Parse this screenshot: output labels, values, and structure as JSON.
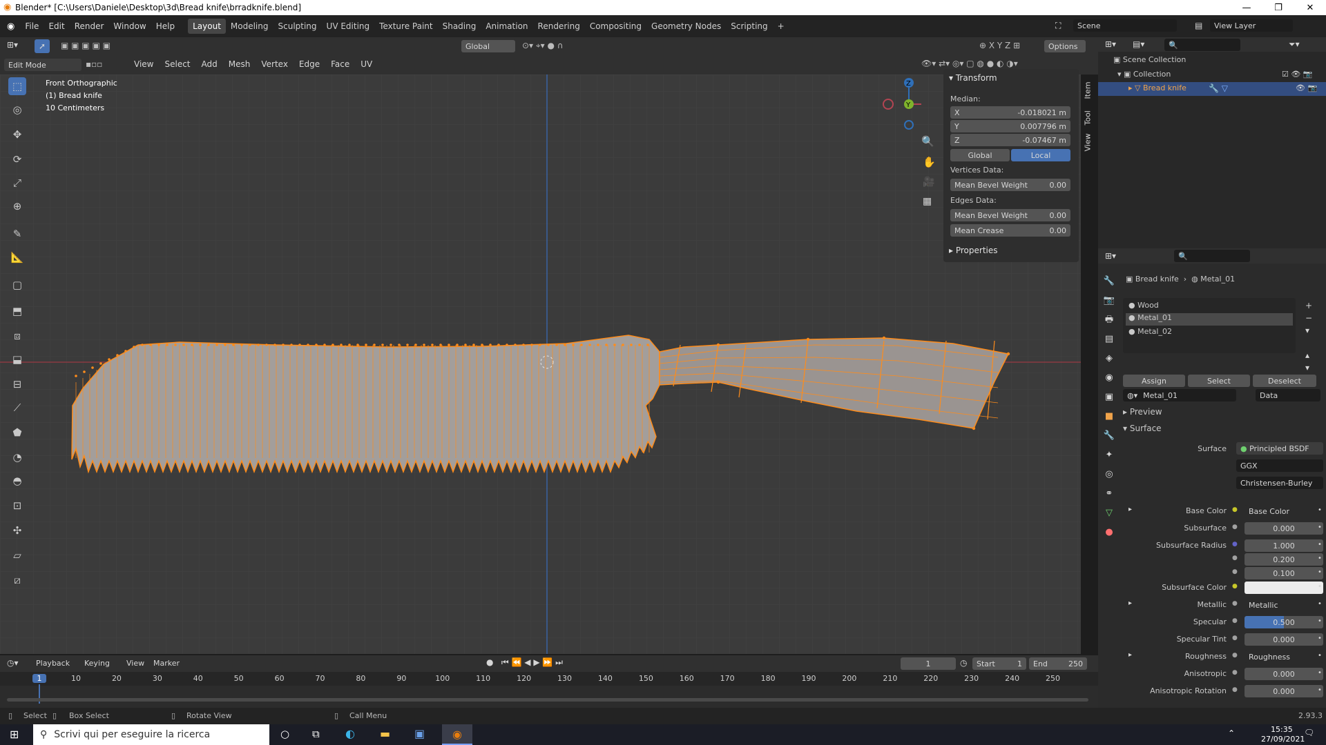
{
  "window": {
    "title": "Blender* [C:\\Users\\Daniele\\Desktop\\3d\\Bread knife\\brradknife.blend]"
  },
  "menus": [
    "File",
    "Edit",
    "Render",
    "Window",
    "Help"
  ],
  "workspaces": [
    "Layout",
    "Modeling",
    "Sculpting",
    "UV Editing",
    "Texture Paint",
    "Shading",
    "Animation",
    "Rendering",
    "Compositing",
    "Geometry Nodes",
    "Scripting"
  ],
  "scene": {
    "label": "Scene",
    "view_layer": "View Layer"
  },
  "header3d": {
    "mode": "Edit Mode",
    "transform_orient": "Global",
    "options": "Options",
    "menus": [
      "View",
      "Select",
      "Add",
      "Mesh",
      "Vertex",
      "Edge",
      "Face",
      "UV"
    ]
  },
  "overlay": {
    "line1": "Front Orthographic",
    "line2": "(1) Bread knife",
    "line3": "10 Centimeters"
  },
  "gizmo": {
    "x": "X",
    "y": "Y",
    "z": "Z"
  },
  "npanel": {
    "transform_title": "Transform",
    "median": "Median:",
    "x_label": "X",
    "x_val": "-0.018021 m",
    "y_label": "Y",
    "y_val": "0.007796 m",
    "z_label": "Z",
    "z_val": "-0.07467 m",
    "global": "Global",
    "local": "Local",
    "vertices_data": "Vertices Data:",
    "v_bevel_label": "Mean Bevel Weight",
    "v_bevel_val": "0.00",
    "edges_data": "Edges Data:",
    "e_bevel_label": "Mean Bevel Weight",
    "e_bevel_val": "0.00",
    "crease_label": "Mean Crease",
    "crease_val": "0.00",
    "properties": "Properties",
    "tabs": [
      "Item",
      "Tool",
      "View"
    ]
  },
  "outliner": {
    "scene_collection": "Scene Collection",
    "collection": "Collection",
    "object": "Bread knife"
  },
  "properties": {
    "breadcrumb_obj": "Bread knife",
    "breadcrumb_mat": "Metal_01",
    "slots": [
      "Wood",
      "Metal_01",
      "Metal_02"
    ],
    "assign": "Assign",
    "select": "Select",
    "deselect": "Deselect",
    "material_name": "Metal_01",
    "data": "Data",
    "preview": "Preview",
    "surface_section": "Surface",
    "surface_label": "Surface",
    "surface_val": "Principled BSDF",
    "distribution": "GGX",
    "subsurface_method": "Christensen-Burley",
    "rows": [
      {
        "label": "Base Color",
        "val": "Base Color"
      },
      {
        "label": "Subsurface",
        "val": "0.000"
      },
      {
        "label": "Subsurface Radius",
        "val": "1.000"
      },
      {
        "label": "",
        "val": "0.200"
      },
      {
        "label": "",
        "val": "0.100"
      },
      {
        "label": "Subsurface Color",
        "val": ""
      },
      {
        "label": "Metallic",
        "val": "Metallic"
      },
      {
        "label": "Specular",
        "val": "0.500"
      },
      {
        "label": "Specular Tint",
        "val": "0.000"
      },
      {
        "label": "Roughness",
        "val": "Roughness"
      },
      {
        "label": "Anisotropic",
        "val": "0.000"
      },
      {
        "label": "Anisotropic Rotation",
        "val": "0.000"
      }
    ],
    "specular_fill": 0.5
  },
  "timeline": {
    "menus": [
      "Playback",
      "Keying",
      "View",
      "Marker"
    ],
    "current_frame": "1",
    "start_label": "Start",
    "start": "1",
    "end_label": "End",
    "end": "250",
    "ticks": [
      "1",
      "10",
      "20",
      "30",
      "40",
      "50",
      "60",
      "70",
      "80",
      "90",
      "100",
      "110",
      "120",
      "130",
      "140",
      "150",
      "160",
      "170",
      "180",
      "190",
      "200",
      "210",
      "220",
      "230",
      "240",
      "250"
    ]
  },
  "status": {
    "select": "Select",
    "box_select": "Box Select",
    "rotate": "Rotate View",
    "call_menu": "Call Menu",
    "version": "2.93.3"
  },
  "taskbar": {
    "search": "Scrivi qui per eseguire la ricerca",
    "time": "15:35",
    "date": "27/09/2021"
  },
  "colors": {
    "accent": "#4772b3",
    "mesh_edge": "#ff8c1a",
    "mesh_face": "#a39e9b",
    "x_axis": "#b34452",
    "z_axis": "#2f6fb8"
  }
}
